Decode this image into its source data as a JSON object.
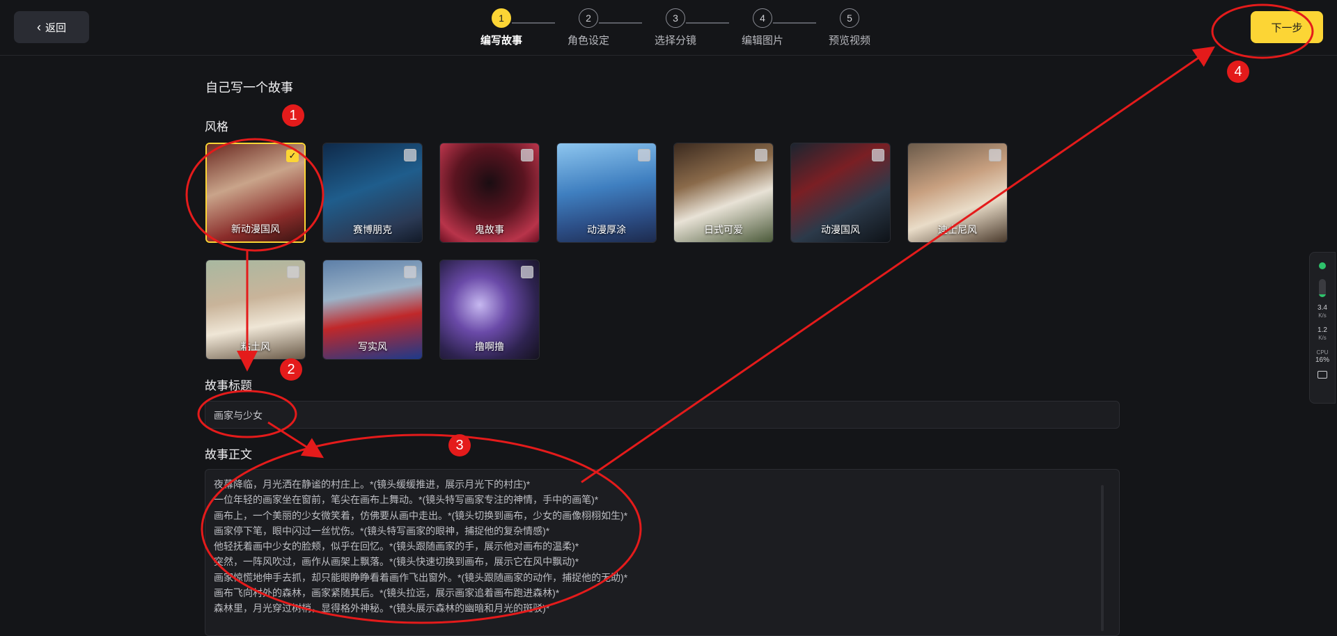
{
  "header": {
    "back_label": "返回",
    "next_label": "下一步",
    "steps": [
      {
        "num": "1",
        "label": "编写故事",
        "active": true
      },
      {
        "num": "2",
        "label": "角色设定",
        "active": false
      },
      {
        "num": "3",
        "label": "选择分镜",
        "active": false
      },
      {
        "num": "4",
        "label": "编辑图片",
        "active": false
      },
      {
        "num": "5",
        "label": "预览视频",
        "active": false
      }
    ]
  },
  "page": {
    "title": "自己写一个故事",
    "style_label": "风格"
  },
  "styles": [
    {
      "name": "新动漫国风",
      "selected": true
    },
    {
      "name": "赛博朋克",
      "selected": false
    },
    {
      "name": "鬼故事",
      "selected": false
    },
    {
      "name": "动漫厚涂",
      "selected": false
    },
    {
      "name": "日式可爱",
      "selected": false
    },
    {
      "name": "动漫国风",
      "selected": false
    },
    {
      "name": "迪士尼风",
      "selected": false
    },
    {
      "name": "粘土风",
      "selected": false
    },
    {
      "name": "写实风",
      "selected": false
    },
    {
      "name": "撸啊撸",
      "selected": false
    }
  ],
  "story": {
    "title_label": "故事标题",
    "title_value": "画家与少女",
    "body_label": "故事正文",
    "body_lines": [
      "夜幕降临，月光洒在静谧的村庄上。*(镜头缓缓推进，展示月光下的村庄)*",
      "一位年轻的画家坐在窗前，笔尖在画布上舞动。*(镜头特写画家专注的神情，手中的画笔)*",
      "画布上，一个美丽的少女微笑着，仿佛要从画中走出。*(镜头切换到画布，少女的画像栩栩如生)*",
      "画家停下笔，眼中闪过一丝忧伤。*(镜头特写画家的眼神，捕捉他的复杂情感)*",
      "他轻抚着画中少女的脸颊，似乎在回忆。*(镜头跟随画家的手，展示他对画布的温柔)*",
      "突然，一阵风吹过，画作从画架上飘落。*(镜头快速切换到画布，展示它在风中飘动)*",
      "画家惊慌地伸手去抓，却只能眼睁睁看着画作飞出窗外。*(镜头跟随画家的动作，捕捉他的无助)*",
      "画布飞向村外的森林，画家紧随其后。*(镜头拉远，展示画家追着画布跑进森林)*",
      "森林里，月光穿过树梢，显得格外神秘。*(镜头展示森林的幽暗和月光的斑驳)*"
    ]
  },
  "annotations": [
    "1",
    "2",
    "3",
    "4"
  ],
  "monitor": {
    "down_speed": "3.4",
    "up_speed": "1.2",
    "speed_unit": "K/s",
    "cpu_label": "CPU",
    "cpu_value": "16%",
    "cpu_level": 0.16
  }
}
